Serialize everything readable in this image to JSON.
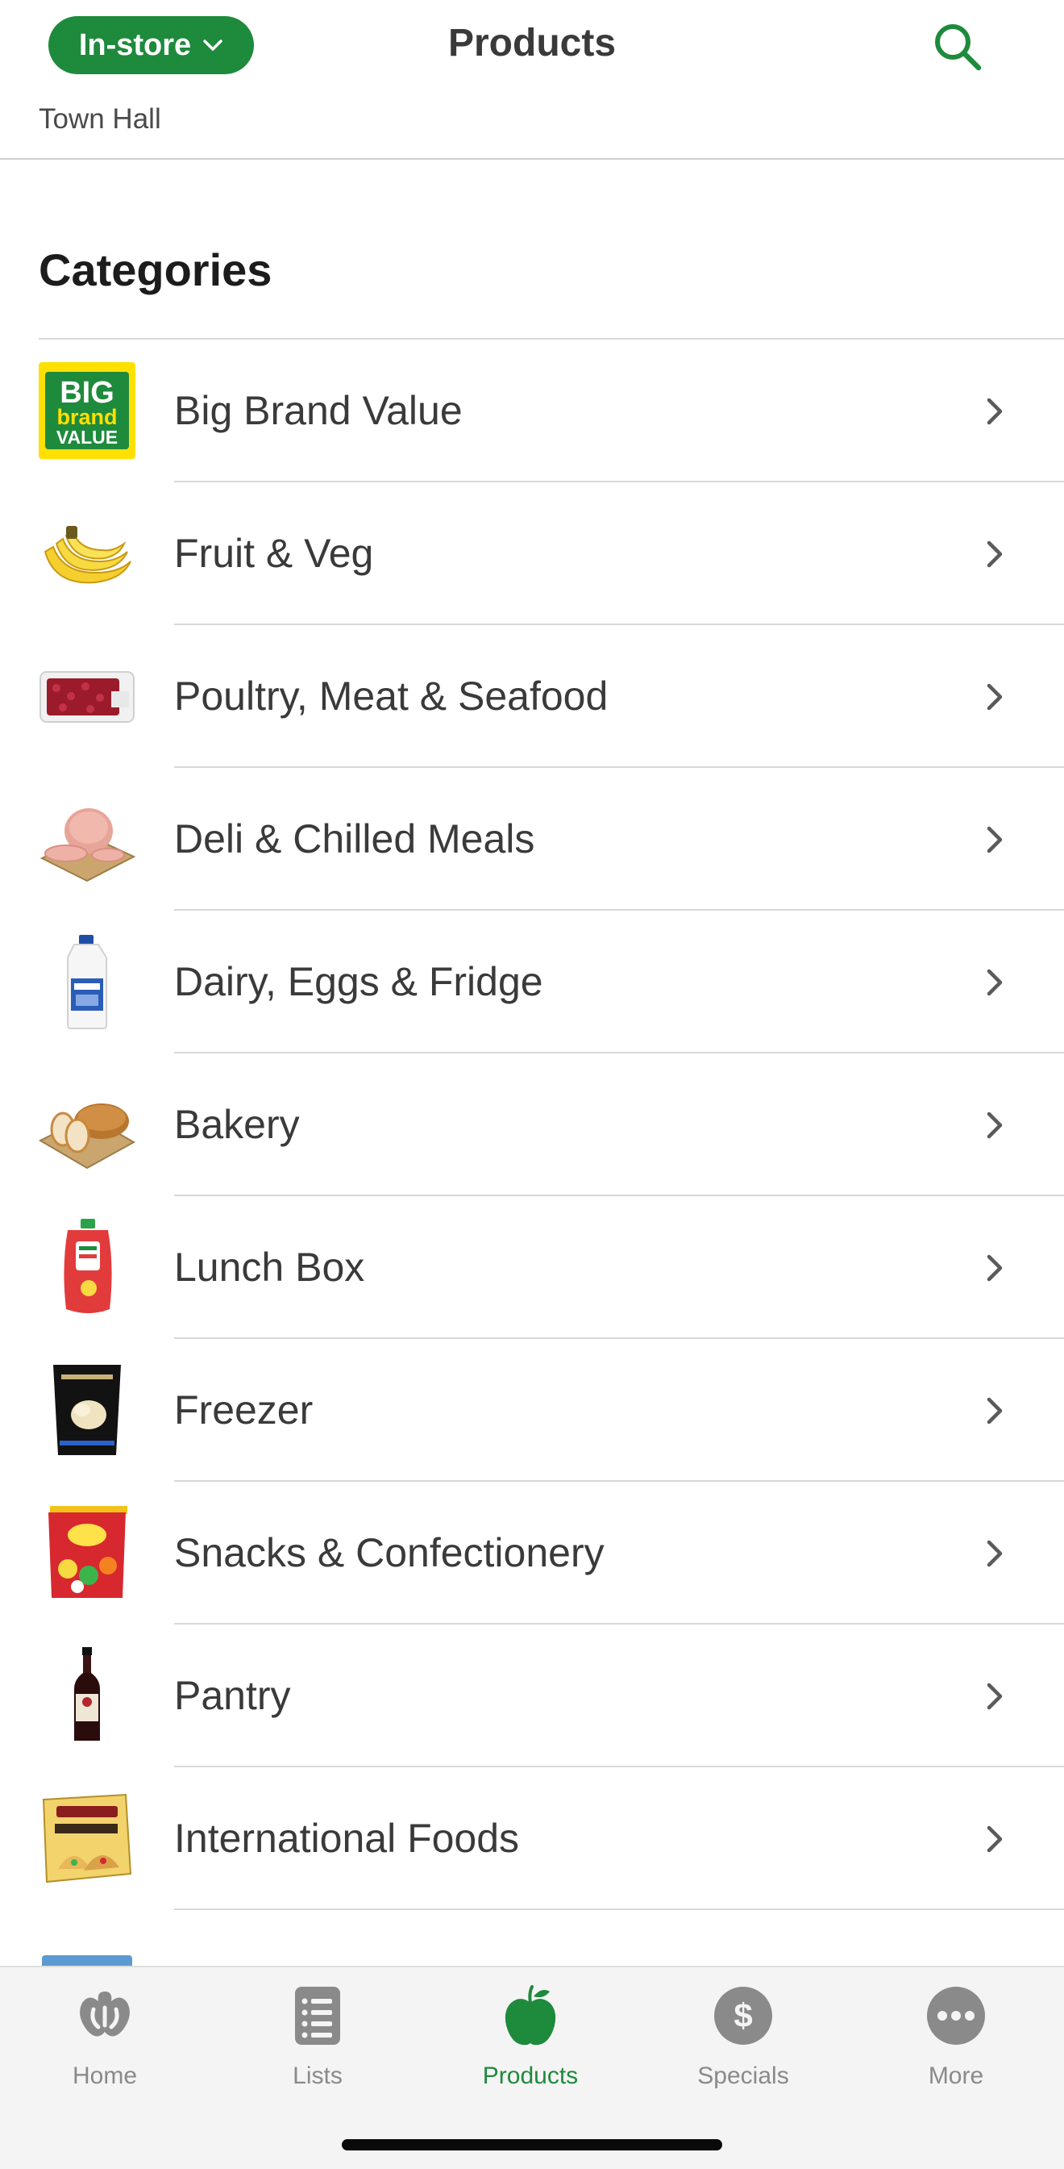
{
  "header": {
    "mode_label": "In-store",
    "title": "Products",
    "store_name": "Town Hall"
  },
  "colors": {
    "brand_green": "#1e8a3c",
    "tab_inactive": "#8a8a8a"
  },
  "section_title": "Categories",
  "thumbnail_logo": {
    "line1": "BIG",
    "line2": "brand",
    "line3": "VALUE"
  },
  "categories": [
    {
      "label": "Big Brand Value",
      "icon": "big-brand-value-logo"
    },
    {
      "label": "Fruit & Veg",
      "icon": "bananas-image"
    },
    {
      "label": "Poultry, Meat & Seafood",
      "icon": "meat-tray-image"
    },
    {
      "label": "Deli & Chilled Meals",
      "icon": "ham-image"
    },
    {
      "label": "Dairy, Eggs & Fridge",
      "icon": "milk-bottle-image"
    },
    {
      "label": "Bakery",
      "icon": "bread-image"
    },
    {
      "label": "Lunch Box",
      "icon": "fruit-pouch-image"
    },
    {
      "label": "Freezer",
      "icon": "ice-cream-tub-image"
    },
    {
      "label": "Snacks & Confectionery",
      "icon": "lolly-bag-image"
    },
    {
      "label": "Pantry",
      "icon": "sauce-bottle-image"
    },
    {
      "label": "International Foods",
      "icon": "taco-kit-image"
    }
  ],
  "tabs": [
    {
      "label": "Home",
      "icon": "woolworths-logo-icon",
      "active": false
    },
    {
      "label": "Lists",
      "icon": "list-icon",
      "active": false
    },
    {
      "label": "Products",
      "icon": "apple-icon",
      "active": true
    },
    {
      "label": "Specials",
      "icon": "dollar-icon",
      "active": false
    },
    {
      "label": "More",
      "icon": "more-dots-icon",
      "active": false
    }
  ]
}
